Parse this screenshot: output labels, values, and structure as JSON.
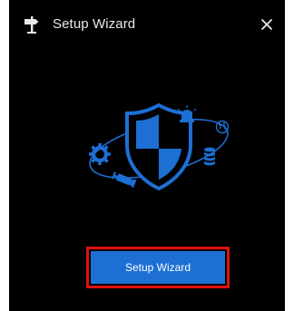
{
  "dialog": {
    "title": "Setup Wizard",
    "title_icon": "signpost-icon",
    "close_icon": "close-icon",
    "close_glyph": "✕"
  },
  "illustration": {
    "icons": [
      "shield-icon",
      "camera-icon",
      "gear-icon",
      "alarm-light-icon",
      "globe-icon",
      "database-icon"
    ],
    "accent_color": "#1d6fd4"
  },
  "main": {
    "setup_button_label": "Setup Wizard"
  },
  "colors": {
    "background": "#000000",
    "button": "#1d6fd4",
    "highlight": "#e01010",
    "title_text": "#e9e9e9"
  }
}
